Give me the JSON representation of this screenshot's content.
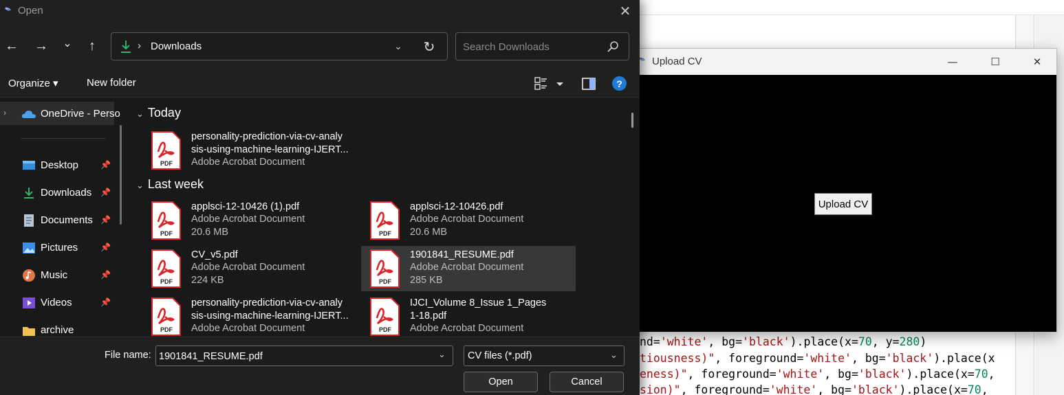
{
  "editor": {
    "code_lines": [
      {
        "a": "nd=",
        "b": "'white'",
        "c": ", bg=",
        "d": "'black'",
        "e": ").place(x=",
        "f": "70",
        "g": ", y=",
        "h": "280",
        "i": ")"
      },
      {
        "a": "tiousness)\"",
        "b": "",
        "c": ", foreground=",
        "d": "'white'",
        "e": ", bg=",
        "f": "'black'",
        "g": ").place(x",
        "h": "",
        "i": ""
      },
      {
        "a": "eness)\"",
        "b": "",
        "c": ", foreground=",
        "d": "'white'",
        "e": ", bg=",
        "f": "'black'",
        "g": ").place(x=",
        "h": "70",
        "i": ","
      },
      {
        "a": "sion)\"",
        "b": "",
        "c": ", foreground=",
        "d": "'white'",
        "e": ", bg=",
        "f": "'black'",
        "g": ").place(x=",
        "h": "70",
        "i": ","
      }
    ]
  },
  "upload_window": {
    "title": "Upload CV",
    "button_label": "Upload CV",
    "minimize_glyph": "—",
    "maximize_glyph": "☐",
    "close_glyph": "✕"
  },
  "dialog": {
    "title": "Open",
    "close_glyph": "✕",
    "nav": {
      "back_glyph": "←",
      "forward_glyph": "→",
      "recent_glyph": "⌄",
      "up_glyph": "↑",
      "refresh_glyph": "↻"
    },
    "address": {
      "separator": "›",
      "location": "Downloads",
      "dropdown_glyph": "⌄"
    },
    "search": {
      "placeholder": "Search Downloads"
    },
    "command_bar": {
      "organize_label": "Organize ▾",
      "new_folder_label": "New folder",
      "help_glyph": "?"
    },
    "nav_pane": {
      "onedrive": {
        "expander": "›",
        "label": "OneDrive - Perso"
      },
      "pin_glyph": "📌",
      "items": [
        {
          "label": "Desktop",
          "icon": "desktop-icon",
          "pinned": true
        },
        {
          "label": "Downloads",
          "icon": "download-icon",
          "pinned": true
        },
        {
          "label": "Documents",
          "icon": "documents-icon",
          "pinned": true
        },
        {
          "label": "Pictures",
          "icon": "pictures-icon",
          "pinned": true
        },
        {
          "label": "Music",
          "icon": "music-icon",
          "pinned": true
        },
        {
          "label": "Videos",
          "icon": "videos-icon",
          "pinned": true
        },
        {
          "label": "archive",
          "icon": "folder-icon",
          "pinned": false
        }
      ]
    },
    "groups": [
      {
        "chevron": "⌄",
        "label": "Today"
      },
      {
        "chevron": "⌄",
        "label": "Last week"
      }
    ],
    "files": [
      {
        "name1": "personality-prediction-via-cv-analy",
        "name2": "sis-using-machine-learning-IJERT...",
        "type": "Adobe Acrobat Document",
        "size": "",
        "selected": false
      },
      {
        "name1": "applsci-12-10426 (1).pdf",
        "name2": "",
        "type": "Adobe Acrobat Document",
        "size": "20.6 MB",
        "selected": false
      },
      {
        "name1": "applsci-12-10426.pdf",
        "name2": "",
        "type": "Adobe Acrobat Document",
        "size": "20.6 MB",
        "selected": false
      },
      {
        "name1": "CV_v5.pdf",
        "name2": "",
        "type": "Adobe Acrobat Document",
        "size": "224 KB",
        "selected": false
      },
      {
        "name1": "1901841_RESUME.pdf",
        "name2": "",
        "type": "Adobe Acrobat Document",
        "size": "285 KB",
        "selected": true
      },
      {
        "name1": "personality-prediction-via-cv-analy",
        "name2": "sis-using-machine-learning-IJERT...",
        "type": "Adobe Acrobat Document",
        "size": "",
        "selected": false
      },
      {
        "name1": "IJCI_Volume 8_Issue 1_Pages",
        "name2": "1-18.pdf",
        "type": "Adobe Acrobat Document",
        "size": "",
        "selected": false
      }
    ],
    "pdf_badge": "PDF",
    "bottom": {
      "file_name_label": "File name:",
      "file_name_value": "1901841_RESUME.pdf",
      "file_type_value": "CV files (*.pdf)",
      "dropdown_glyph": "⌄",
      "open_label": "Open",
      "cancel_label": "Cancel"
    }
  },
  "colors": {
    "dialog_bg": "#191919",
    "pdf_red": "#d9252a",
    "download_green": "#2fb36b",
    "help_blue": "#1f7ad8"
  }
}
